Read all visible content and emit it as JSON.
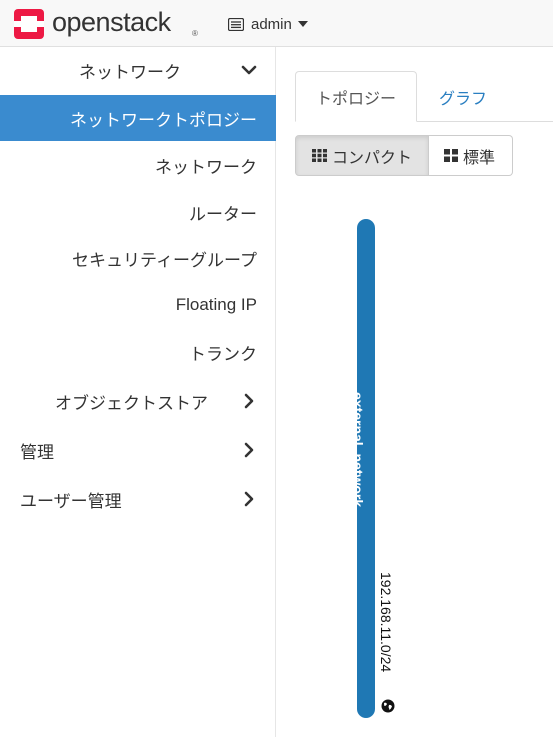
{
  "header": {
    "brand": "openstack",
    "brand_tm": "®",
    "project": "admin",
    "project_icon": "server-icon",
    "brand_color": "#ed1944"
  },
  "sidebar": {
    "items": [
      {
        "label": "ネットワーク",
        "kind": "group-open",
        "icon": "chevron-down-icon"
      },
      {
        "label": "ネットワークトポロジー",
        "kind": "active"
      },
      {
        "label": "ネットワーク",
        "kind": "sub"
      },
      {
        "label": "ルーター",
        "kind": "sub"
      },
      {
        "label": "セキュリティーグループ",
        "kind": "sub"
      },
      {
        "label": "Floating IP",
        "kind": "sub"
      },
      {
        "label": "トランク",
        "kind": "sub"
      },
      {
        "label": "オブジェクトストア",
        "kind": "group",
        "icon": "chevron-right-icon"
      },
      {
        "label": "管理",
        "kind": "panel",
        "icon": "chevron-right-icon"
      },
      {
        "label": "ユーザー管理",
        "kind": "panel",
        "icon": "chevron-right-icon"
      }
    ],
    "active_color": "#3a8bcf"
  },
  "tabs": [
    {
      "label": "トポロジー",
      "active": true
    },
    {
      "label": "グラフ",
      "active": false
    }
  ],
  "view_toggle": {
    "compact_label": "コンパクト",
    "normal_label": "標準",
    "selected": "compact"
  },
  "topology": {
    "network_name": "external_network",
    "cidr": "192.168.11.0/24",
    "network_color": "#1f78b4",
    "external_icon": "globe-icon"
  }
}
